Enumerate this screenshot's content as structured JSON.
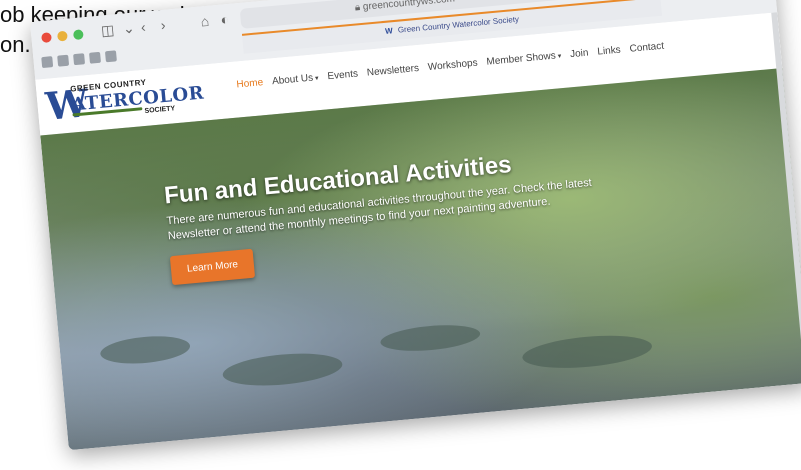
{
  "caption": {
    "line1": "ob keeping our website up",
    "line2": "on."
  },
  "browser": {
    "url": "greencountryws.com",
    "tab_title": "Green Country Watercolor Society",
    "tab_favicon": "W"
  },
  "site": {
    "logo": {
      "letter": "W",
      "top_line": "GREEN COUNTRY",
      "word": "ATERCOLOR",
      "bottom_line": "SOCIETY"
    },
    "nav": [
      {
        "label": "Home",
        "active": true
      },
      {
        "label": "About Us",
        "dropdown": true
      },
      {
        "label": "Events"
      },
      {
        "label": "Newsletters"
      },
      {
        "label": "Workshops"
      },
      {
        "label": "Member Shows",
        "dropdown": true
      },
      {
        "label": "Join"
      },
      {
        "label": "Links"
      },
      {
        "label": "Contact"
      }
    ],
    "hero": {
      "title": "Fun and Educational Activities",
      "description": "There are numerous fun and educational activities throughout the year. Check the latest Newsletter or attend the monthly meetings to find your next painting adventure.",
      "button": "Learn More"
    }
  },
  "colors": {
    "accent": "#e8752a",
    "brand": "#2a4c95"
  }
}
